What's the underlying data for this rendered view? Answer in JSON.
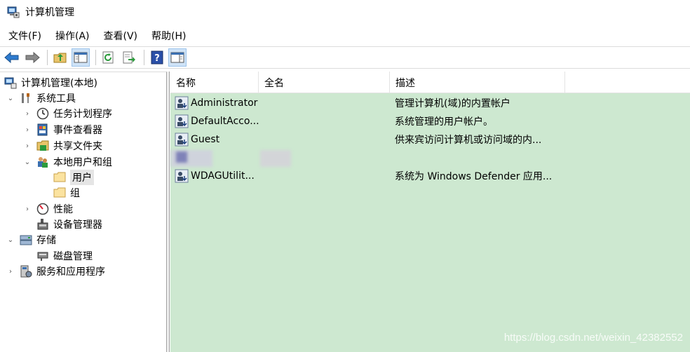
{
  "window": {
    "title": "计算机管理"
  },
  "menu": [
    {
      "label": "文件(F)"
    },
    {
      "label": "操作(A)"
    },
    {
      "label": "查看(V)"
    },
    {
      "label": "帮助(H)"
    }
  ],
  "toolbar": {
    "buttons": [
      "back-icon",
      "forward-icon",
      "up-folder-icon",
      "show-hide-tree-icon",
      "refresh-icon",
      "export-list-icon",
      "help-icon",
      "show-hide-action-pane-icon"
    ]
  },
  "tree": {
    "root": "计算机管理(本地)",
    "system_tools": "系统工具",
    "task_scheduler": "任务计划程序",
    "event_viewer": "事件查看器",
    "shared_folders": "共享文件夹",
    "local_users_groups": "本地用户和组",
    "users": "用户",
    "groups": "组",
    "performance": "性能",
    "device_manager": "设备管理器",
    "storage": "存储",
    "disk_management": "磁盘管理",
    "services_apps": "服务和应用程序",
    "selected": "用户"
  },
  "list": {
    "columns": [
      "名称",
      "全名",
      "描述"
    ],
    "rows": [
      {
        "name": "Administrator",
        "fullname": "",
        "description": "管理计算机(域)的内置帐户"
      },
      {
        "name": "DefaultAcco...",
        "fullname": "",
        "description": "系统管理的用户帐户。"
      },
      {
        "name": "Guest",
        "fullname": "",
        "description": "供来宾访问计算机或访问域的内..."
      },
      {
        "name": "",
        "fullname": "",
        "description": ""
      },
      {
        "name": "WDAGUtilit...",
        "fullname": "",
        "description": "系统为 Windows Defender 应用..."
      }
    ]
  },
  "watermark": "https://blog.csdn.net/weixin_42382552",
  "colors": {
    "list_background": "#cde8d0",
    "selection": "#e5e5e5",
    "accent": "#1a73c8"
  }
}
